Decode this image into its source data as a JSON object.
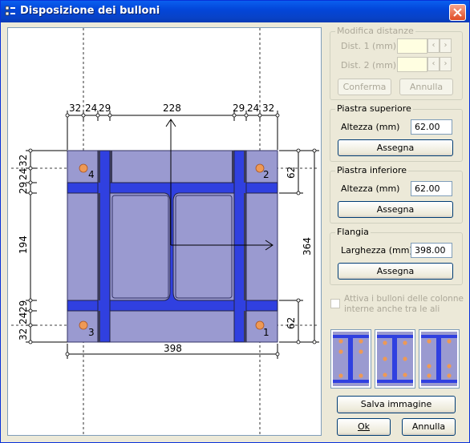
{
  "window": {
    "title": "Disposizione dei bulloni"
  },
  "drawing": {
    "top_dims": [
      "32",
      "24",
      "29",
      "228",
      "29",
      "24",
      "32"
    ],
    "bottom_dim": "398",
    "left_dims": [
      "32",
      "24",
      "29",
      "194",
      "29",
      "24",
      "32"
    ],
    "right_dims": [
      "62",
      "364",
      "62"
    ],
    "bolt_labels": [
      "4",
      "2",
      "3",
      "1"
    ]
  },
  "distances": {
    "title": "Modifica distanze",
    "dist1_label": "Dist. 1 (mm)",
    "dist2_label": "Dist. 2 (mm)",
    "dist1_value": "",
    "dist2_value": "",
    "confirm_label": "Conferma",
    "cancel_label": "Annulla"
  },
  "top_plate": {
    "title": "Piastra superiore",
    "height_label": "Altezza (mm)",
    "height_value": "62.00",
    "assign_label": "Assegna"
  },
  "bottom_plate": {
    "title": "Piastra inferiore",
    "height_label": "Altezza (mm)",
    "height_value": "62.00",
    "assign_label": "Assegna"
  },
  "flange": {
    "title": "Flangia",
    "width_label": "Larghezza (mm)",
    "width_value": "398.00",
    "assign_label": "Assegna"
  },
  "inner_bolts": {
    "label_line1": "Attiva i bulloni delle colonne",
    "label_line2": "interne anche tra le ali"
  },
  "actions": {
    "save_image_label": "Salva immagine",
    "ok_label": "Ok",
    "cancel_label": "Annulla"
  },
  "colors": {
    "plate": "#9999cc",
    "stiffener": "#3344dd",
    "bolt": "#ee9955",
    "dark": "#333366"
  }
}
